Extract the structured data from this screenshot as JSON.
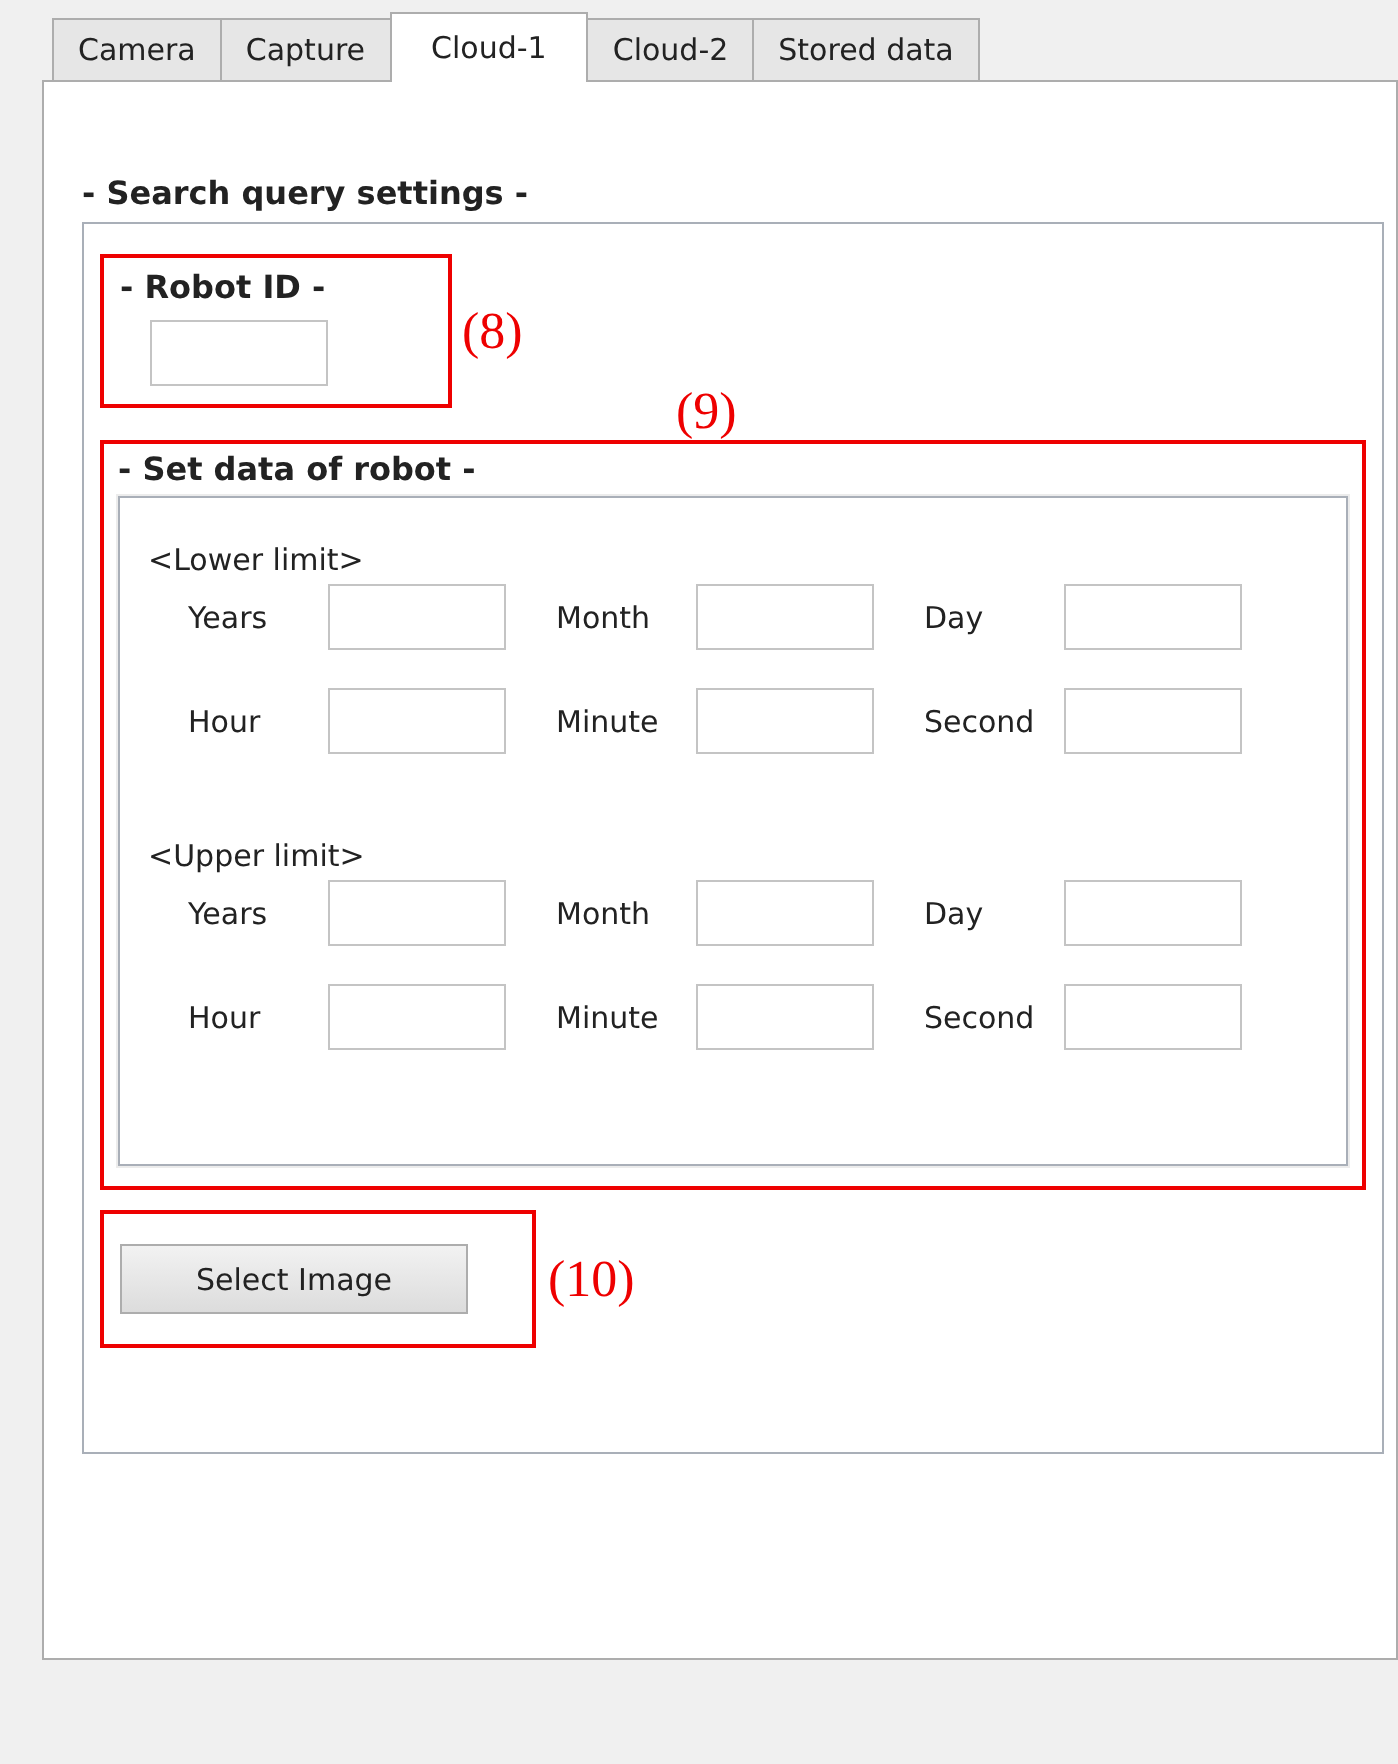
{
  "tabs": [
    {
      "label": "Camera",
      "selected": false
    },
    {
      "label": "Capture",
      "selected": false
    },
    {
      "label": "Cloud-1",
      "selected": true
    },
    {
      "label": "Cloud-2",
      "selected": false
    },
    {
      "label": "Stored data",
      "selected": false
    }
  ],
  "search_query": {
    "title": "- Search query settings -",
    "robot_id": {
      "title": "- Robot ID -",
      "annotation": "(8)"
    },
    "set_data": {
      "title": "- Set data of robot -",
      "annotation": "(9)",
      "limits": [
        {
          "heading": "<Lower limit>",
          "rows": [
            [
              {
                "label": "Years"
              },
              {
                "label": "Month"
              },
              {
                "label": "Day"
              }
            ],
            [
              {
                "label": "Hour"
              },
              {
                "label": "Minute"
              },
              {
                "label": "Second"
              }
            ]
          ]
        },
        {
          "heading": "<Upper limit>",
          "rows": [
            [
              {
                "label": "Years"
              },
              {
                "label": "Month"
              },
              {
                "label": "Day"
              }
            ],
            [
              {
                "label": "Hour"
              },
              {
                "label": "Minute"
              },
              {
                "label": "Second"
              }
            ]
          ]
        }
      ]
    },
    "select_button": {
      "label": "Select Image",
      "annotation": "(10)"
    }
  }
}
